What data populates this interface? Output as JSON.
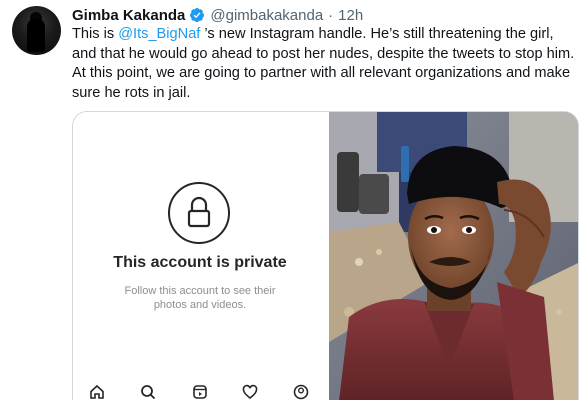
{
  "tweet": {
    "author_name": "Gimba Kakanda",
    "handle": "@gimbakakanda",
    "separator": "·",
    "time": "12h",
    "text_before_mention": "This is ",
    "mention": "@Its_BigNaf",
    "text_after_mention": " ’s new Instagram handle. He’s still threatening the girl, and that he would go ahead to post her nudes, despite the tweets to stop him. At this point, we are going to partner with all relevant organizations and make sure he rots in jail.",
    "verified": true
  },
  "instagram_screenshot": {
    "title": "This account is private",
    "subtitle": "Follow this account to see their photos and videos.",
    "nav_icons": [
      "home-icon",
      "search-icon",
      "reels-icon",
      "heart-icon",
      "profile-icon"
    ]
  },
  "photo": {
    "icon": "selfie-photo"
  },
  "colors": {
    "link": "#1d9bf0",
    "verified_badge": "#1d9bf0",
    "secondary_text": "#536471",
    "card_border": "#cfd9de"
  }
}
